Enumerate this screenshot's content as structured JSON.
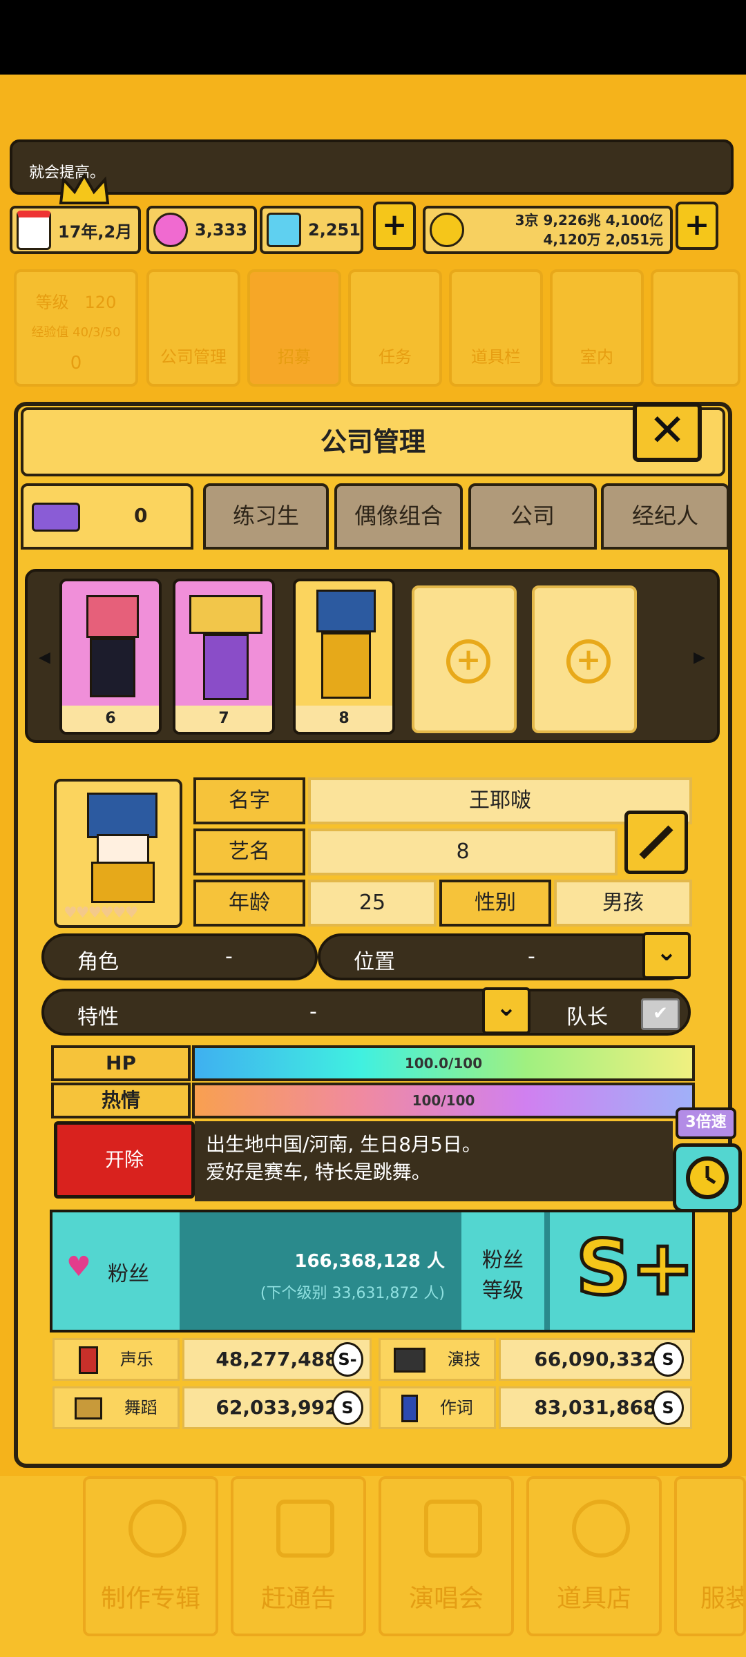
{
  "notice": {
    "text": "就会提高。"
  },
  "resources": {
    "date": "17年,2月",
    "gems_pink": "3,333",
    "gems_blue": "2,251",
    "money_line1": "3京 9,226兆 4,100亿",
    "money_line2": "4,120万 2,051元"
  },
  "bg_menu": {
    "level_label": "等级",
    "level_value": "120",
    "exp_label": "经验值",
    "exp_value": "40/3/50",
    "exp_num": "0",
    "items": [
      "公司管理",
      "招募",
      "任务",
      "道具栏",
      "室内"
    ]
  },
  "modal": {
    "title": "公司管理",
    "close": "✕",
    "count": "0",
    "tabs": [
      "练习生",
      "偶像组合",
      "公司",
      "经纪人"
    ]
  },
  "roster": {
    "cards": [
      {
        "number": "6",
        "color": "#f08fd9"
      },
      {
        "number": "7",
        "color": "#f08fd9"
      },
      {
        "number": "8",
        "color": "#fbd45e"
      }
    ]
  },
  "profile": {
    "name_label": "名字",
    "name_value": "王耶啵",
    "stage_label": "艺名",
    "stage_value": "8",
    "age_label": "年龄",
    "age_value": "25",
    "gender_label": "性别",
    "gender_value": "男孩",
    "role_label": "角色",
    "role_value": "-",
    "position_label": "位置",
    "position_value": "-",
    "trait_label": "特性",
    "trait_value": "-",
    "leader_label": "队长",
    "hp_label": "HP",
    "hp_value": "100.0/100",
    "hp_fraction": 1.0,
    "passion_label": "热情",
    "passion_value": "100/100",
    "passion_fraction": 1.0,
    "fire_button": "开除",
    "bio_line1": "出生地中国/河南, 生日8月5日。",
    "bio_line2": "爱好是赛车, 特长是跳舞。",
    "speed": "3倍速"
  },
  "fans": {
    "label": "粉丝",
    "count": "166,368,128 人",
    "next": "(下个级别 33,631,872 人)",
    "level_label_1": "粉丝",
    "level_label_2": "等级",
    "grade": "S+"
  },
  "stats": [
    {
      "label": "声乐",
      "value": "48,277,488",
      "grade": "S-"
    },
    {
      "label": "演技",
      "value": "66,090,332",
      "grade": "S"
    },
    {
      "label": "舞蹈",
      "value": "62,033,992",
      "grade": "S"
    },
    {
      "label": "作词",
      "value": "83,031,868",
      "grade": "S"
    }
  ],
  "bottom_nav": [
    "制作专辑",
    "赶通告",
    "演唱会",
    "道具店",
    "服装"
  ],
  "colors": {
    "accent": "#f5b31b",
    "dark": "#3a2f1c",
    "teal": "#2a8a8c",
    "red": "#d9221e"
  }
}
